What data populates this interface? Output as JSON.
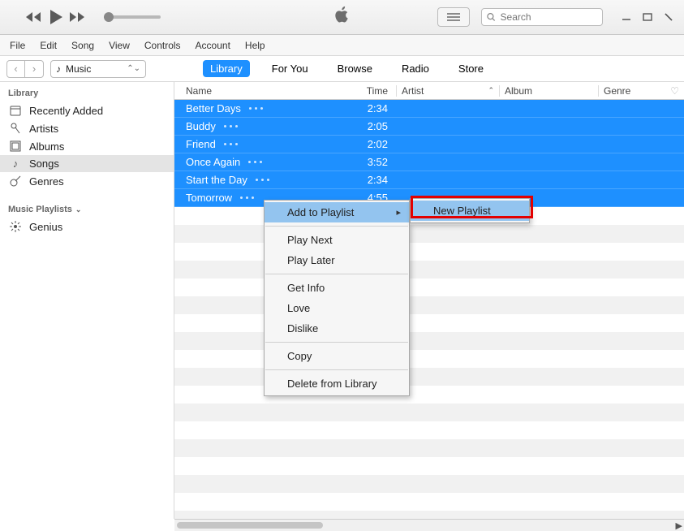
{
  "toolbar": {
    "search_placeholder": "Search"
  },
  "menubar": [
    "File",
    "Edit",
    "Song",
    "View",
    "Controls",
    "Account",
    "Help"
  ],
  "media_selector": {
    "label": "Music"
  },
  "tabs": [
    {
      "label": "Library",
      "active": true
    },
    {
      "label": "For You",
      "active": false
    },
    {
      "label": "Browse",
      "active": false
    },
    {
      "label": "Radio",
      "active": false
    },
    {
      "label": "Store",
      "active": false
    }
  ],
  "sidebar": {
    "library_header": "Library",
    "items": [
      {
        "label": "Recently Added",
        "icon": "clock-icon"
      },
      {
        "label": "Artists",
        "icon": "mic-icon"
      },
      {
        "label": "Albums",
        "icon": "album-icon"
      },
      {
        "label": "Songs",
        "icon": "note-icon",
        "selected": true
      },
      {
        "label": "Genres",
        "icon": "guitar-icon"
      }
    ],
    "playlists_header": "Music Playlists",
    "playlists": [
      {
        "label": "Genius",
        "icon": "genius-icon"
      }
    ]
  },
  "columns": {
    "name": "Name",
    "time": "Time",
    "artist": "Artist",
    "album": "Album",
    "genre": "Genre"
  },
  "songs": [
    {
      "name": "Better Days",
      "time": "2:34"
    },
    {
      "name": "Buddy",
      "time": "2:05"
    },
    {
      "name": "Friend",
      "time": "2:02"
    },
    {
      "name": "Once Again",
      "time": "3:52"
    },
    {
      "name": "Start the Day",
      "time": "2:34"
    },
    {
      "name": "Tomorrow",
      "time": "4:55"
    }
  ],
  "context_menu": {
    "add_to_playlist": "Add to Playlist",
    "play_next": "Play Next",
    "play_later": "Play Later",
    "get_info": "Get Info",
    "love": "Love",
    "dislike": "Dislike",
    "copy": "Copy",
    "delete": "Delete from Library"
  },
  "submenu": {
    "new_playlist": "New Playlist"
  }
}
